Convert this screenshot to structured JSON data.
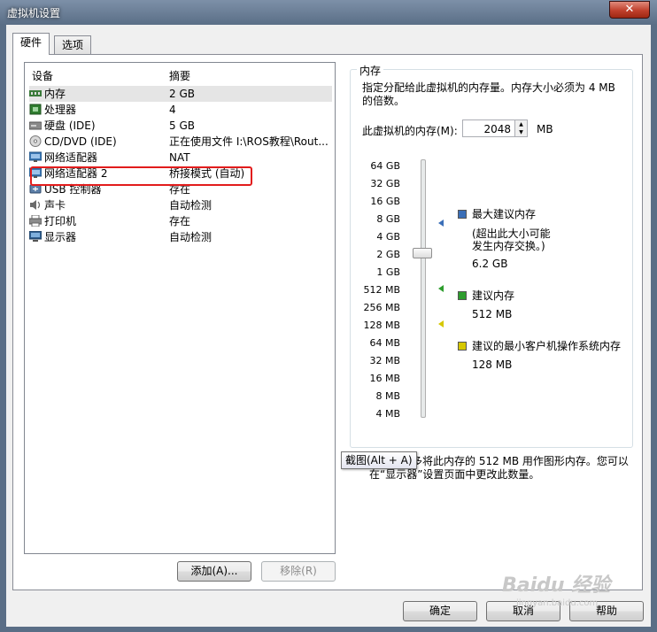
{
  "window": {
    "title": "虚拟机设置",
    "close": "✕"
  },
  "tabs": [
    {
      "label": "硬件"
    },
    {
      "label": "选项"
    }
  ],
  "device_list": {
    "header_device": "设备",
    "header_summary": "摘要",
    "rows": [
      {
        "name": "内存",
        "summary": "2 GB",
        "icon": "memory-icon"
      },
      {
        "name": "处理器",
        "summary": "4",
        "icon": "cpu-icon"
      },
      {
        "name": "硬盘 (IDE)",
        "summary": "5 GB",
        "icon": "hard-disk-icon"
      },
      {
        "name": "CD/DVD (IDE)",
        "summary": "正在使用文件 I:\\ROS教程\\Rout...",
        "icon": "cd-dvd-icon"
      },
      {
        "name": "网络适配器",
        "summary": "NAT",
        "icon": "network-adapter-icon"
      },
      {
        "name": "网络适配器 2",
        "summary": "桥接模式 (自动)",
        "icon": "network-adapter-icon"
      },
      {
        "name": "USB 控制器",
        "summary": "存在",
        "icon": "usb-icon"
      },
      {
        "name": "声卡",
        "summary": "自动检测",
        "icon": "sound-card-icon"
      },
      {
        "name": "打印机",
        "summary": "存在",
        "icon": "printer-icon"
      },
      {
        "name": "显示器",
        "summary": "自动检测",
        "icon": "display-icon"
      }
    ]
  },
  "buttons": {
    "add": "添加(A)...",
    "remove": "移除(R)",
    "ok": "确定",
    "cancel": "取消",
    "help": "帮助"
  },
  "memory": {
    "legend": "内存",
    "description": "指定分配给此虚拟机的内存量。内存大小必须为 4 MB 的倍数。",
    "field_label": "此虚拟机的内存(M):",
    "value": "2048",
    "unit": "MB",
    "ticks": [
      "64 GB",
      "32 GB",
      "16 GB",
      "8 GB",
      "4 GB",
      "2 GB",
      "1 GB",
      "512 MB",
      "256 MB",
      "128 MB",
      "64 MB",
      "32 MB",
      "16 MB",
      "8 MB",
      "4 MB"
    ],
    "max_recommended": {
      "title": "最大建议内存",
      "note1": "(超出此大小可能",
      "note2": "发生内存交换。)",
      "value": "6.2 GB"
    },
    "recommended": {
      "title": "建议内存",
      "value": "512 MB"
    },
    "min_recommended": {
      "title": "建议的最小客户机操作系统内存",
      "value": "128 MB"
    },
    "colors": {
      "max": "#3b6fb8",
      "recommended": "#2e9d2e",
      "min": "#d6c800"
    }
  },
  "tooltip": "截图(Alt + A)",
  "graphics_note": {
    "line1": "多将此内存的 512 MB 用作图形内存。您可以",
    "line2": "在“显示器”设置页面中更改此数量。"
  },
  "watermark": {
    "brand": "Baidu 经验",
    "url": "jingyan.baidu.com"
  }
}
